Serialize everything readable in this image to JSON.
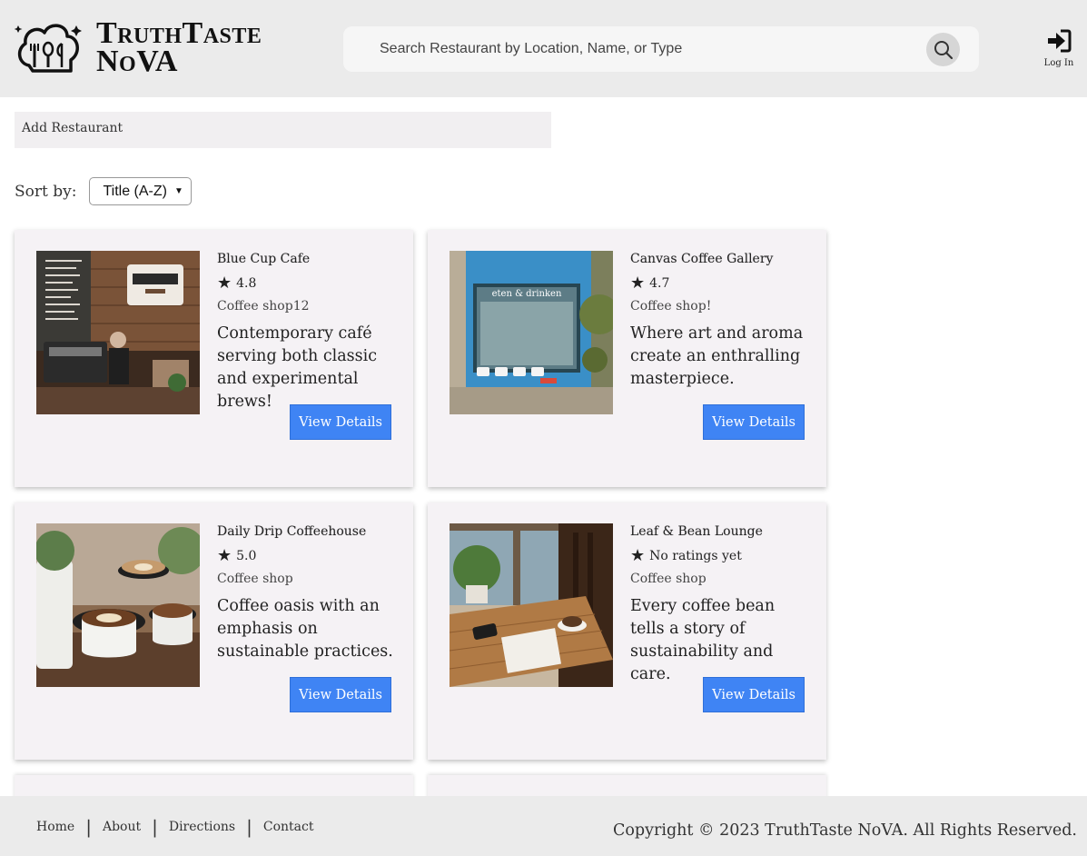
{
  "brand": {
    "name_line1": "TruthTaste",
    "name_line2": "NoVA"
  },
  "search": {
    "placeholder": "Search Restaurant by Location, Name, or Type"
  },
  "login": {
    "label": "Log In"
  },
  "add_restaurant": {
    "label": "Add Restaurant"
  },
  "sort": {
    "label": "Sort by:",
    "selected": "Title (A-Z)"
  },
  "cards": [
    {
      "name": "Blue Cup Cafe",
      "rating": "4.8",
      "type": "Coffee shop12",
      "description": "Contemporary café serving both classic and experimental brews!",
      "button": "View Details",
      "image": "cafe-counter-photo"
    },
    {
      "name": "Canvas Coffee Gallery",
      "rating": "4.7",
      "type": "Coffee shop!",
      "description": "Where art and aroma create an enthralling masterpiece.",
      "button": "View Details",
      "image": "blue-storefront-photo",
      "sign_text": "eten & drinken"
    },
    {
      "name": "Daily Drip Coffeehouse",
      "rating": "5.0",
      "type": "Coffee shop",
      "description": "Coffee oasis with an emphasis on sustainable practices.",
      "button": "View Details",
      "image": "latte-cups-photo"
    },
    {
      "name": "Leaf & Bean Lounge",
      "rating": "No ratings yet",
      "type": "Coffee shop",
      "description": "Every coffee bean tells a story of sustainability and care.",
      "button": "View Details",
      "image": "window-table-photo"
    }
  ],
  "footer": {
    "links": [
      "Home",
      "About",
      "Directions",
      "Contact"
    ],
    "copyright": "Copyright © 2023 TruthTaste NoVA. All Rights Reserved."
  },
  "colors": {
    "header_bg": "#ebebeb",
    "button_blue": "#3f84f4",
    "card_bg": "#f5f2f5"
  }
}
